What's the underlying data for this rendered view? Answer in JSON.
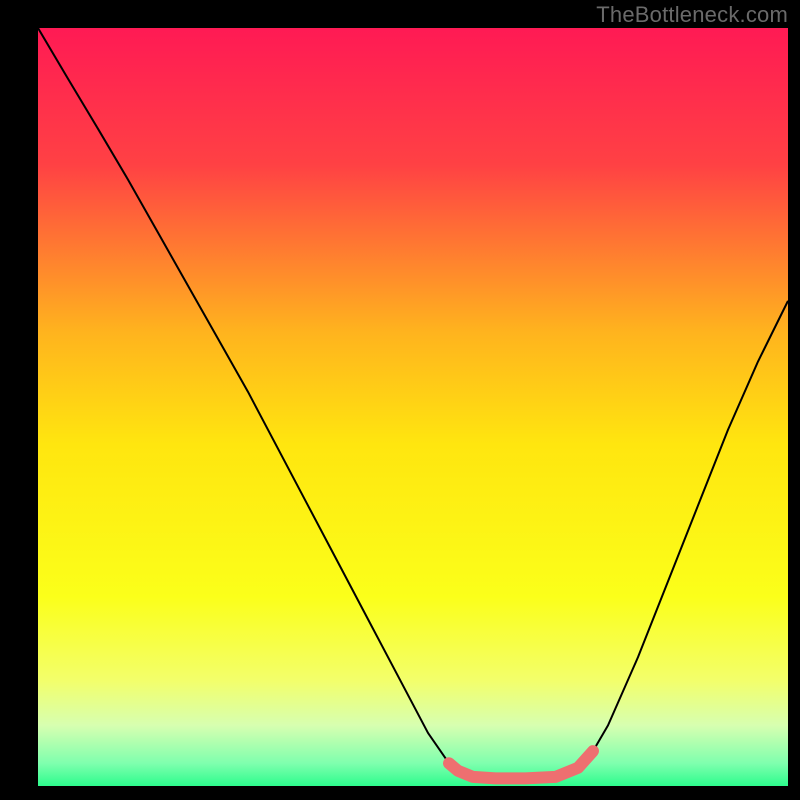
{
  "watermark": "TheBottleneck.com",
  "chart_data": {
    "type": "line",
    "title": "",
    "xlabel": "",
    "ylabel": "",
    "xlim": [
      0,
      1
    ],
    "ylim": [
      0,
      1
    ],
    "grid": false,
    "background_gradient": {
      "stops": [
        {
          "offset": 0.0,
          "color": "#ff1a54"
        },
        {
          "offset": 0.18,
          "color": "#ff4144"
        },
        {
          "offset": 0.4,
          "color": "#ffb31e"
        },
        {
          "offset": 0.55,
          "color": "#ffe60f"
        },
        {
          "offset": 0.75,
          "color": "#fbff1a"
        },
        {
          "offset": 0.86,
          "color": "#f3ff6a"
        },
        {
          "offset": 0.92,
          "color": "#d7ffb0"
        },
        {
          "offset": 0.97,
          "color": "#7fffae"
        },
        {
          "offset": 1.0,
          "color": "#2dfc8d"
        }
      ]
    },
    "series": [
      {
        "name": "curve",
        "color": "#000000",
        "width": 2,
        "x": [
          0.0,
          0.04,
          0.08,
          0.12,
          0.16,
          0.2,
          0.24,
          0.28,
          0.32,
          0.36,
          0.4,
          0.44,
          0.48,
          0.52,
          0.548,
          0.56,
          0.58,
          0.61,
          0.65,
          0.69,
          0.72,
          0.74,
          0.76,
          0.8,
          0.84,
          0.88,
          0.92,
          0.96,
          1.0
        ],
        "y": [
          1.0,
          0.933,
          0.867,
          0.8,
          0.73,
          0.66,
          0.59,
          0.52,
          0.445,
          0.37,
          0.295,
          0.22,
          0.145,
          0.07,
          0.03,
          0.02,
          0.012,
          0.01,
          0.01,
          0.012,
          0.024,
          0.046,
          0.08,
          0.17,
          0.27,
          0.37,
          0.47,
          0.56,
          0.64
        ]
      },
      {
        "name": "highlight",
        "color": "#ee6f70",
        "width": 12,
        "linecap": "round",
        "x": [
          0.548,
          0.56,
          0.58,
          0.61,
          0.65,
          0.69,
          0.72,
          0.74
        ],
        "y": [
          0.03,
          0.02,
          0.012,
          0.01,
          0.01,
          0.012,
          0.024,
          0.046
        ]
      }
    ]
  }
}
